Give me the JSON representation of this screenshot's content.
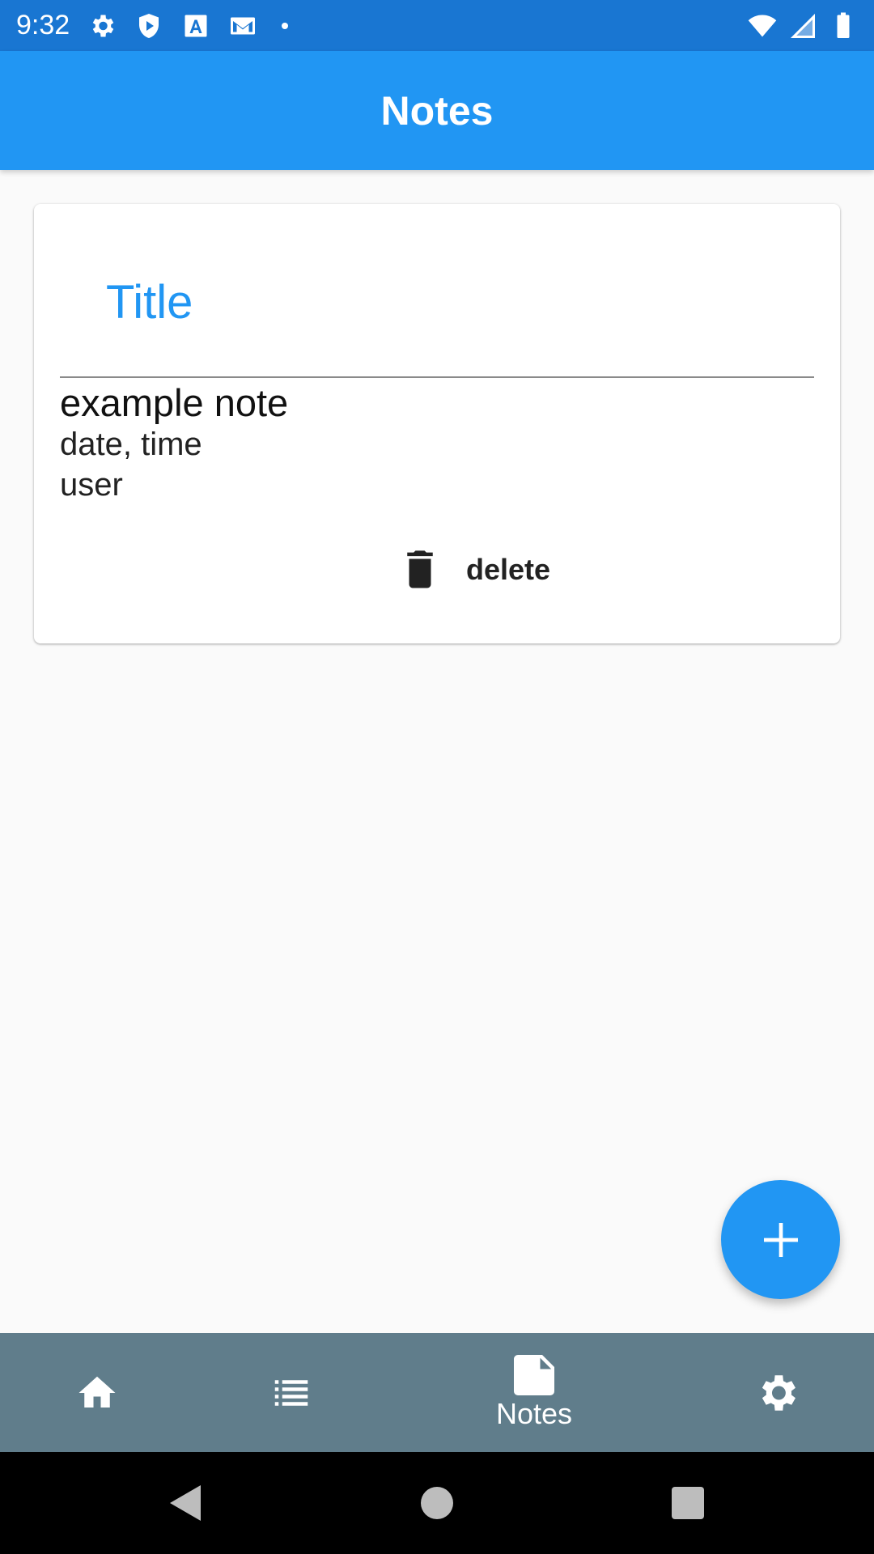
{
  "status_bar": {
    "time": "9:32",
    "left_icons": [
      "settings-icon",
      "shield-play-icon",
      "font-download-icon",
      "gmail-icon"
    ],
    "right_icons": [
      "wifi-icon",
      "cell-signal-icon",
      "battery-icon"
    ]
  },
  "app_bar": {
    "title": "Notes"
  },
  "note": {
    "title": "Title",
    "text": "example note",
    "date": "date, time",
    "user": "user",
    "delete_label": "delete"
  },
  "fab": {
    "icon": "plus-icon"
  },
  "bottom_nav": {
    "items": [
      {
        "icon": "home-icon",
        "label": ""
      },
      {
        "icon": "list-icon",
        "label": ""
      },
      {
        "icon": "note-icon",
        "label": "Notes",
        "selected": true
      },
      {
        "icon": "settings-icon",
        "label": ""
      }
    ]
  },
  "colors": {
    "status_bar": "#1976d2",
    "primary": "#2196f3",
    "bottom_nav": "#607d8b",
    "background": "#fafafa"
  }
}
